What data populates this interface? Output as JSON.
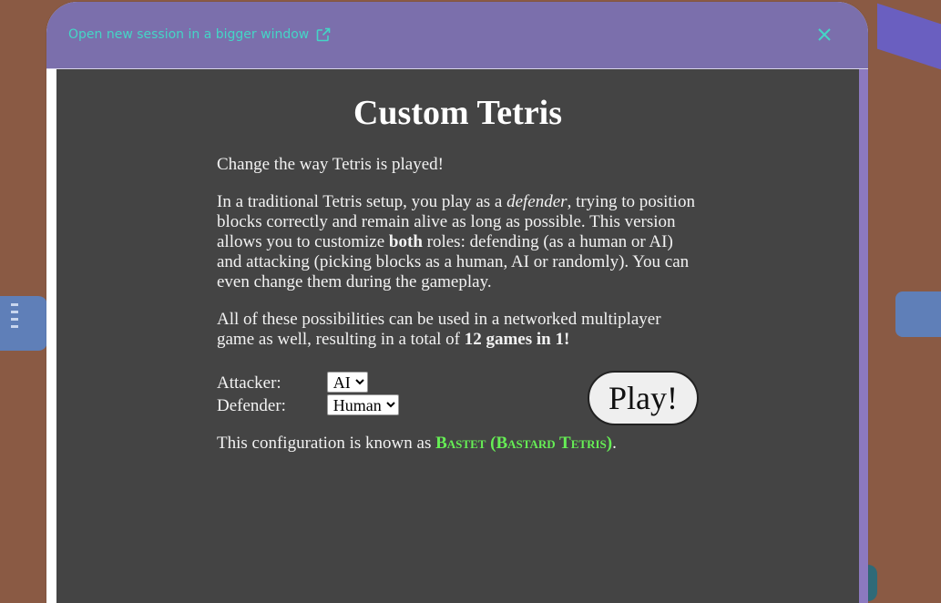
{
  "header": {
    "open_link_label": "Open new session in a bigger window",
    "accent_color": "#44d6c6",
    "header_bg": "#7b6fac"
  },
  "icons": {
    "external_link": "external-link-icon",
    "close": "close-icon"
  },
  "page": {
    "title": "Custom Tetris",
    "intro": "Change the way Tetris is played!",
    "para2": {
      "part1": "In a traditional Tetris setup, you play as a ",
      "em": "defender",
      "part2": ", trying to position blocks correctly and remain alive as long as possible. This version allows you to customize ",
      "strong": "both",
      "part3": " roles: defending (as a human or AI) and attacking (picking blocks as a human, AI or randomly). You can even change them during the gameplay."
    },
    "para3": {
      "part1": "All of these possibilities can be used in a networked multiplayer game as well, resulting in a total of ",
      "strong": "12 games in 1!"
    },
    "attacker_label": "Attacker:",
    "attacker_value": "AI",
    "defender_label": "Defender:",
    "defender_value": "Human",
    "play_label": "Play!",
    "config_prefix": "This configuration is known as ",
    "config_name": "Bastet (Bastard Tetris)",
    "config_suffix": ".",
    "config_color": "#66ee55",
    "content_bg": "#444444"
  }
}
